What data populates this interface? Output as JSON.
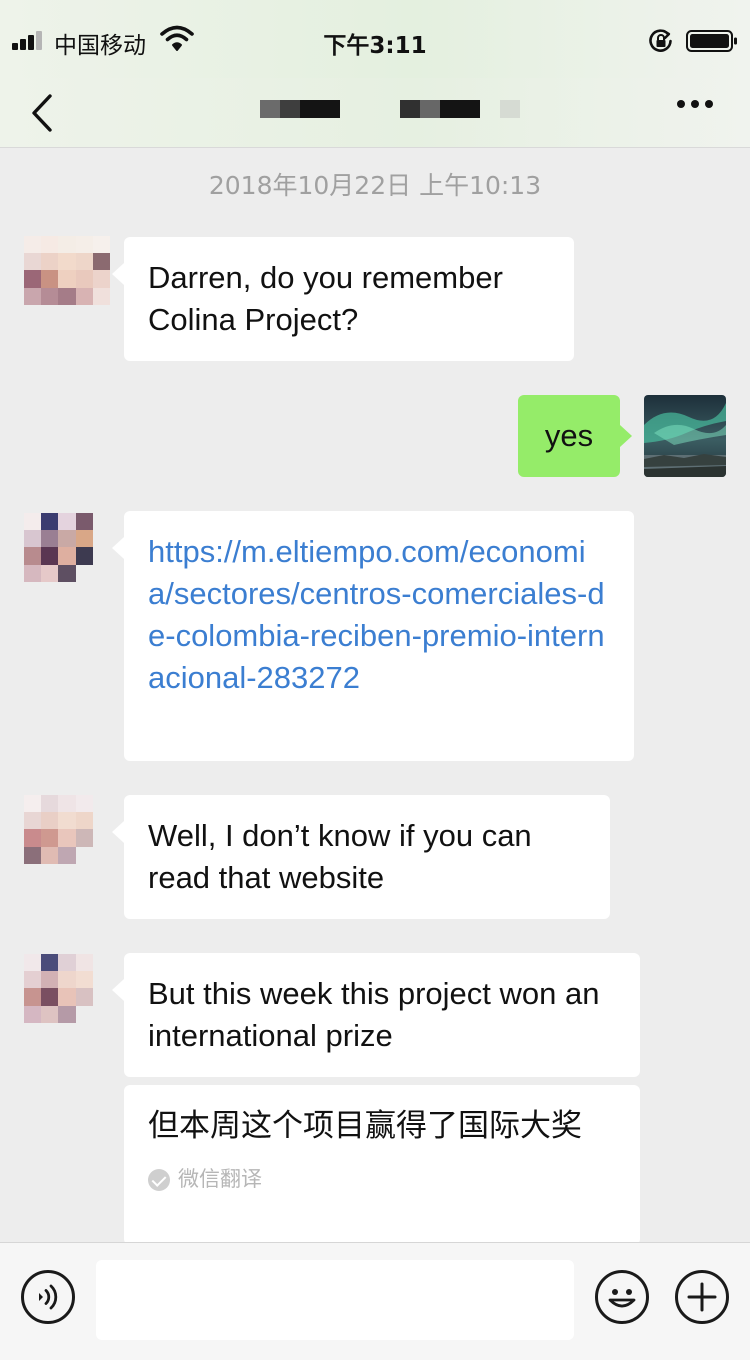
{
  "status_bar": {
    "carrier": "中国移动",
    "time": "下午3:11"
  },
  "header": {
    "back_icon": "chevron-left-icon",
    "more_icon": "more-dots-icon"
  },
  "chat": {
    "timestamp": "2018年10月22日 上午10:13",
    "messages": [
      {
        "side": "left",
        "text": "Darren, do you remember Colina Project?"
      },
      {
        "side": "right",
        "text": "yes"
      },
      {
        "side": "left",
        "text": "https://m.eltiempo.com/economia/sectores/centros-comerciales-de-colombia-reciben-premio-internacional-283272"
      },
      {
        "side": "left",
        "text": "Well, I don’t know if you can read that website"
      },
      {
        "side": "left",
        "text": "But this week this project won an international prize"
      },
      {
        "side": "left",
        "text": "但本周这个项目赢得了国际大奖",
        "note": "微信翻译"
      }
    ]
  },
  "input_bar": {
    "voice_icon": "voice-icon",
    "emoji_icon": "emoji-icon",
    "plus_icon": "plus-icon",
    "input_value": ""
  },
  "colors": {
    "background": "#ededed",
    "own_bubble": "#95ec69",
    "link": "#3b7ed1"
  }
}
